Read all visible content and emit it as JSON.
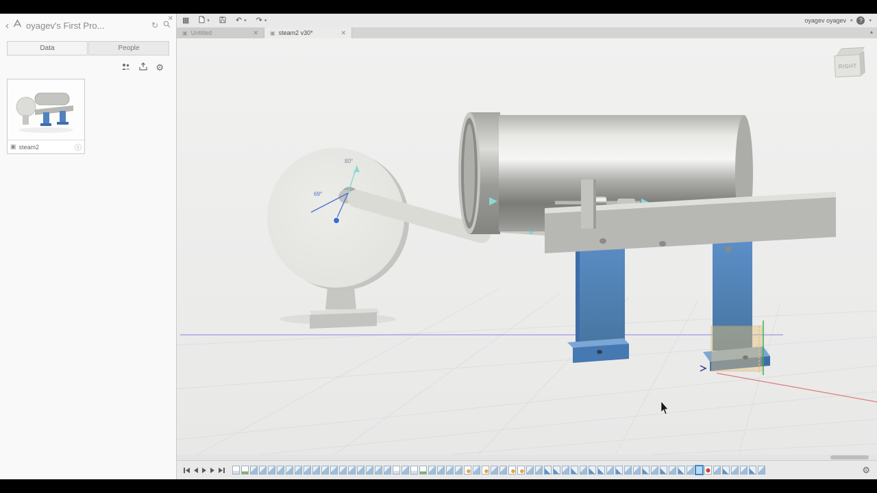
{
  "app": {
    "user_name": "oyagev oyagev",
    "help_label": "?"
  },
  "panel": {
    "title": "oyagev's First Pro...",
    "tabs": [
      {
        "label": "Data"
      },
      {
        "label": "People"
      }
    ],
    "item": {
      "name": "steam2"
    }
  },
  "doc_tabs": [
    {
      "label": "Untitled"
    },
    {
      "label": "steam2 v30*"
    }
  ],
  "viewcube": {
    "face": "RIGHT"
  },
  "viewport": {
    "annotations": {
      "angle1": "80°",
      "angle2": "69°"
    }
  },
  "colors": {
    "stand_blue": "#4f82c0",
    "selection_tan": "#e9c47d",
    "axis_blue": "#8585e0",
    "axis_red": "#e07a7a",
    "axis_green": "#3fae4a"
  },
  "timeline": {
    "ops": [
      "doc",
      "sketch",
      "joint",
      "joint",
      "joint",
      "joint",
      "joint",
      "joint",
      "joint",
      "joint",
      "joint",
      "joint",
      "joint",
      "joint",
      "joint",
      "joint",
      "joint",
      "joint",
      "doc",
      "joint",
      "doc",
      "sketch",
      "joint",
      "joint",
      "joint",
      "joint",
      "warn",
      "joint",
      "warn",
      "joint",
      "joint",
      "warn",
      "warn",
      "joint",
      "joint",
      "pos",
      "pos",
      "joint",
      "pos",
      "joint",
      "pos",
      "pos",
      "joint",
      "pos",
      "joint",
      "joint",
      "pos",
      "joint",
      "pos",
      "joint",
      "pos",
      "joint",
      "sel",
      "red",
      "joint",
      "pos",
      "joint",
      "joint",
      "pos",
      "joint"
    ]
  }
}
